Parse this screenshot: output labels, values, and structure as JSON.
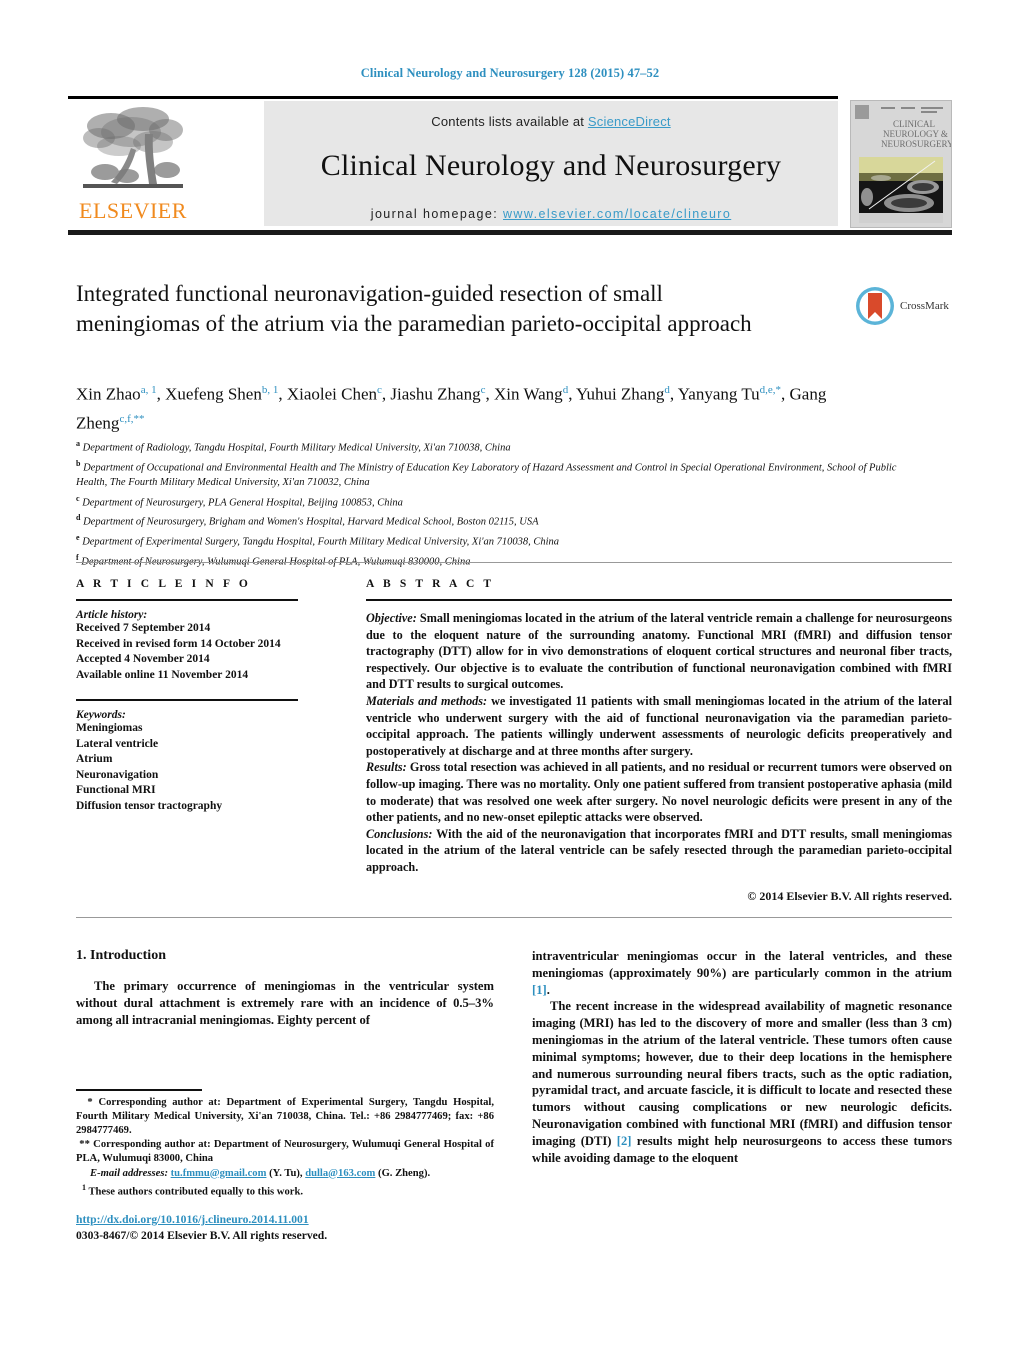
{
  "running_head": "Clinical Neurology and Neurosurgery 128 (2015) 47–52",
  "masthead": {
    "contents_prefix": "Contents lists available at ",
    "sciencedirect": "ScienceDirect",
    "journal_title": "Clinical Neurology and Neurosurgery",
    "homepage_prefix": "journal homepage: ",
    "homepage_url": "www.elsevier.com/locate/clineuro",
    "publisher": "ELSEVIER",
    "cover_title_line1": "CLINICAL",
    "cover_title_line2": "NEUROLOGY &",
    "cover_title_line3": "NEUROSURGERY",
    "accent_blue": "#3a9bc8",
    "elsevier_orange": "#f08a1e",
    "band_grey": "#e7e7e7"
  },
  "article": {
    "title": "Integrated functional neuronavigation-guided resection of small meningiomas of the atrium via the paramedian parieto-occipital approach",
    "crossmark_label": "CrossMark",
    "authors_html": "Xin Zhao<sup>a, 1</sup>, Xuefeng Shen<sup>b, 1</sup>, Xiaolei Chen<sup>c</sup>, Jiashu Zhang<sup>c</sup>, Xin Wang<sup>d</sup>, Yuhui Zhang<sup>d</sup>, Yanyang Tu<sup>d,e,</sup><sup>*</sup>, Gang Zheng<sup>c,f,</sup><sup>**</sup>",
    "affiliations": [
      {
        "mark": "a",
        "text": "Department of Radiology, Tangdu Hospital, Fourth Military Medical University, Xi'an 710038, China"
      },
      {
        "mark": "b",
        "text": "Department of Occupational and Environmental Health and The Ministry of Education Key Laboratory of Hazard Assessment and Control in Special Operational Environment, School of Public Health, The Fourth Military Medical University, Xi'an 710032, China"
      },
      {
        "mark": "c",
        "text": "Department of Neurosurgery, PLA General Hospital, Beijing 100853, China"
      },
      {
        "mark": "d",
        "text": "Department of Neurosurgery, Brigham and Women's Hospital, Harvard Medical School, Boston 02115, USA"
      },
      {
        "mark": "e",
        "text": "Department of Experimental Surgery, Tangdu Hospital, Fourth Military Medical University, Xi'an 710038, China"
      },
      {
        "mark": "f",
        "text": "Department of Neurosurgery, Wulumuqi General Hospital of PLA, Wulumuqi 830000, China"
      }
    ]
  },
  "article_info": {
    "heading": "A R T I C L E   I N F O",
    "history_label": "Article history:",
    "history": [
      "Received 7 September 2014",
      "Received in revised form 14 October 2014",
      "Accepted 4 November 2014",
      "Available online 11 November 2014"
    ],
    "keywords_label": "Keywords:",
    "keywords": [
      "Meningiomas",
      "Lateral ventricle",
      "Atrium",
      "Neuronavigation",
      "Functional MRI",
      "Diffusion tensor tractography"
    ]
  },
  "abstract": {
    "heading": "A B S T R A C T",
    "sections": [
      {
        "label": "Objective:",
        "text": " Small meningiomas located in the atrium of the lateral ventricle remain a challenge for neurosurgeons due to the eloquent nature of the surrounding anatomy. Functional MRI (fMRI) and diffusion tensor tractography (DTT) allow for in vivo demonstrations of eloquent cortical structures and neuronal fiber tracts, respectively. Our objective is to evaluate the contribution of functional neuronavigation combined with fMRI and DTT results to surgical outcomes."
      },
      {
        "label": "Materials and methods:",
        "text": " we investigated 11 patients with small meningiomas located in the atrium of the lateral ventricle who underwent surgery with the aid of functional neuronavigation via the paramedian parieto-occipital approach. The patients willingly underwent assessments of neurologic deficits preoperatively and postoperatively at discharge and at three months after surgery."
      },
      {
        "label": "Results:",
        "text": " Gross total resection was achieved in all patients, and no residual or recurrent tumors were observed on follow-up imaging. There was no mortality. Only one patient suffered from transient postoperative aphasia (mild to moderate) that was resolved one week after surgery. No novel neurologic deficits were present in any of the other patients, and no new-onset epileptic attacks were observed."
      },
      {
        "label": "Conclusions:",
        "text": " With the aid of the neuronavigation that incorporates fMRI and DTT results, small meningiomas located in the atrium of the lateral ventricle can be safely resected through the paramedian parieto-occipital approach."
      }
    ],
    "copyright": "© 2014 Elsevier B.V. All rights reserved."
  },
  "body": {
    "section_heading": "1.  Introduction",
    "left_paragraph": "The primary occurrence of meningiomas in the ventricular system without dural attachment is extremely rare with an incidence of 0.5–3% among all intracranial meningiomas. Eighty percent of",
    "right_paragraph_1_pre": "intraventricular meningiomas occur in the lateral ventricles, and these meningiomas (approximately 90%) are particularly common in the atrium ",
    "right_paragraph_1_ref": "[1]",
    "right_paragraph_1_post": ".",
    "right_paragraph_2_pre": "The recent increase in the widespread availability of magnetic resonance imaging (MRI) has led to the discovery of more and smaller (less than 3 cm) meningiomas in the atrium of the lateral ventricle. These tumors often cause minimal symptoms; however, due to their deep locations in the hemisphere and numerous surrounding neural fibers tracts, such as the optic radiation, pyramidal tract, and arcuate fascicle, it is difficult to locate and resected these tumors without causing complications or new neurologic deficits. Neuronavigation combined with functional MRI (fMRI) and diffusion tensor imaging (DTI) ",
    "right_paragraph_2_ref": "[2]",
    "right_paragraph_2_post": " results might help neurosurgeons to access these tumors while avoiding damage to the eloquent"
  },
  "footnotes": {
    "corresponding_1": "Corresponding author at: Department of Experimental Surgery, Tangdu Hospital, Fourth Military Medical University, Xi'an 710038, China. Tel.: +86 2984777469; fax: +86 2984777469.",
    "corresponding_1_marker": "*",
    "corresponding_2": "Corresponding author at: Department of Neurosurgery, Wulumuqi General Hospital of PLA, Wulumuqi 83000, China",
    "corresponding_2_marker": "**",
    "email_label": "E-mail addresses:",
    "email_1": "tu.fmmu@gmail.com",
    "email_1_attrib": " (Y. Tu), ",
    "email_2": "dulla@163.com",
    "email_2_attrib": " (G. Zheng).",
    "equal_contrib_marker": "1",
    "equal_contrib": " These authors contributed equally to this work."
  },
  "footer": {
    "doi": "http://dx.doi.org/10.1016/j.clineuro.2014.11.001",
    "issn": "0303-8467/© 2014 Elsevier B.V. All rights reserved."
  }
}
